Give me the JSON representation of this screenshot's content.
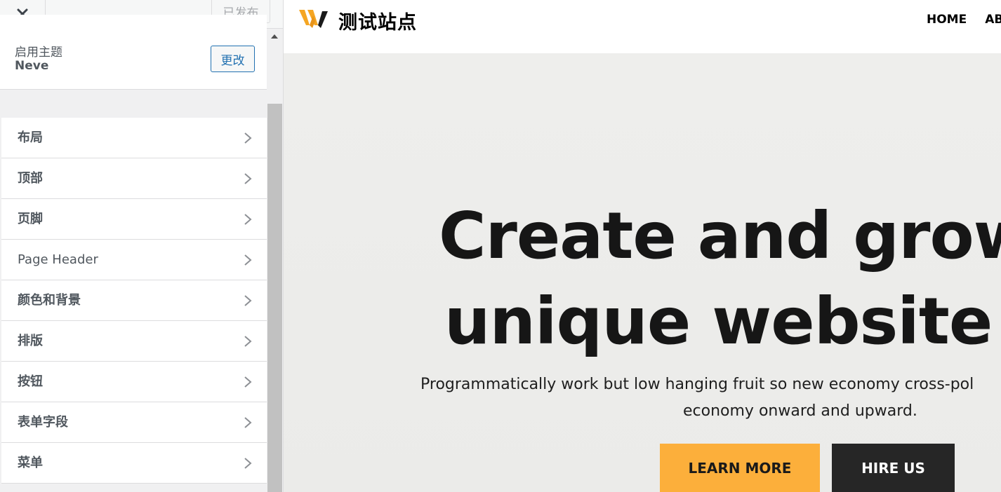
{
  "sidebar": {
    "close_label": "×",
    "publish_label": "已发布",
    "active_theme": {
      "label": "启用主题",
      "name": "Neve",
      "change_label": "更改"
    },
    "sections": [
      {
        "label": "布局"
      },
      {
        "label": "顶部"
      },
      {
        "label": "页脚"
      },
      {
        "label": "Page Header"
      },
      {
        "label": "颜色和背景"
      },
      {
        "label": "排版"
      },
      {
        "label": "按钮"
      },
      {
        "label": "表单字段"
      },
      {
        "label": "菜单"
      }
    ]
  },
  "preview": {
    "site_title": "测试站点",
    "logo_icon": "neve-w-logo-icon",
    "nav": [
      "HOME",
      "AB"
    ],
    "hero": {
      "title_line1": "Create and grow",
      "title_line2": "unique website t",
      "subtitle_line1": "Programmatically work but low hanging fruit so new economy cross-pol",
      "subtitle_line2": "economy onward and upward.",
      "primary_button": "LEARN MORE",
      "secondary_button": "HIRE US"
    },
    "colors": {
      "accent": "#fcaf3b",
      "dark": "#262626",
      "admin_blue": "#2271b1"
    }
  }
}
